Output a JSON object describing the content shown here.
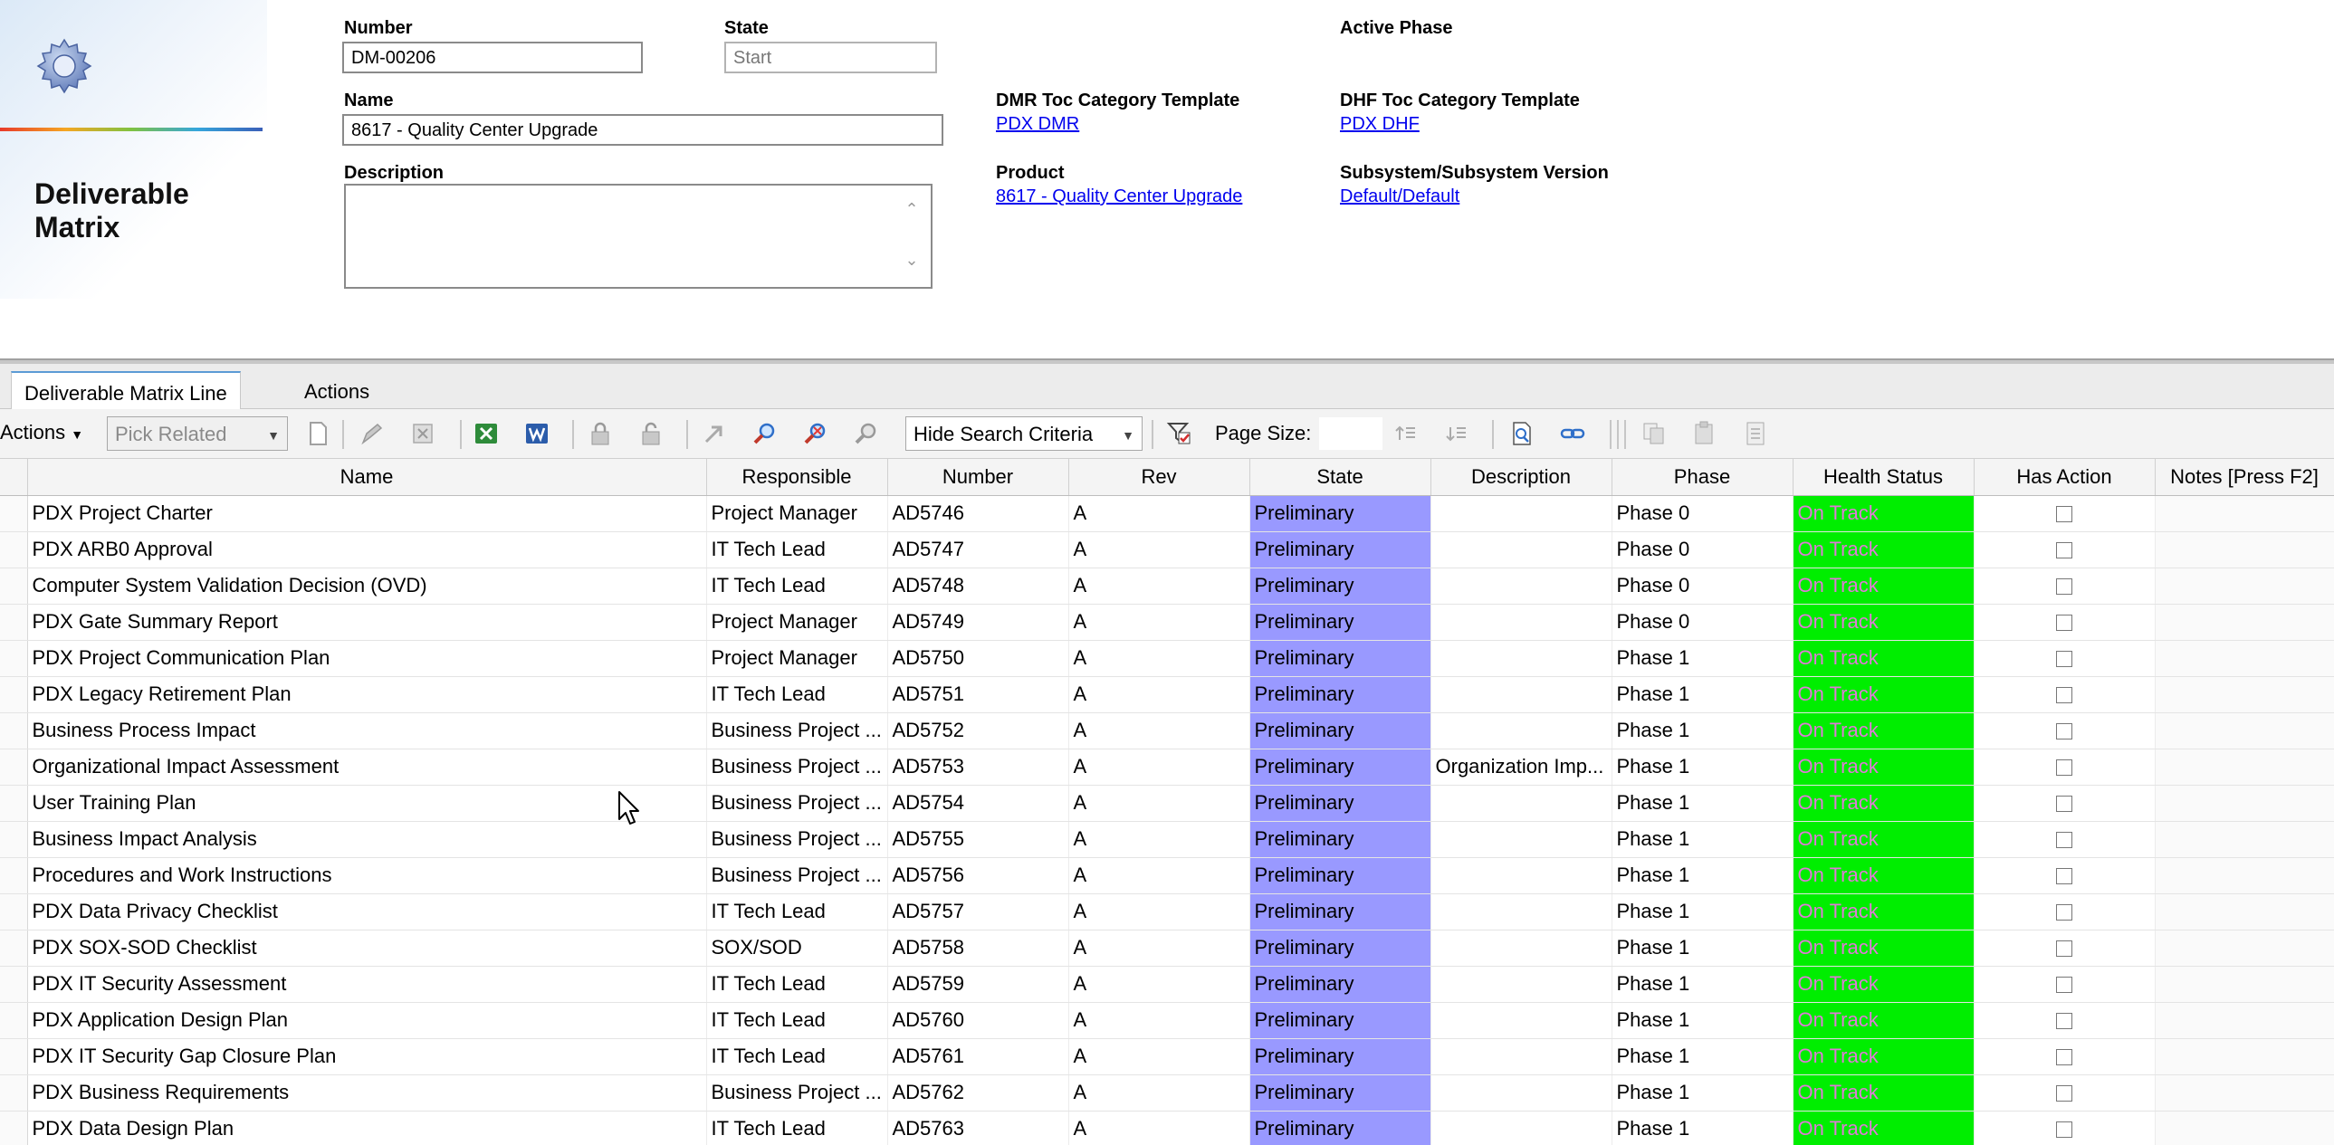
{
  "header": {
    "title": "Deliverable Matrix",
    "number": {
      "label": "Number",
      "value": "DM-00206"
    },
    "state": {
      "label": "State",
      "value": "Start"
    },
    "name": {
      "label": "Name",
      "value": "8617 - Quality Center Upgrade"
    },
    "description": {
      "label": "Description",
      "value": ""
    },
    "active_phase": {
      "label": "Active Phase"
    },
    "dmr_toc": {
      "label": "DMR Toc Category Template",
      "link": "PDX DMR"
    },
    "product": {
      "label": "Product",
      "link": "8617 - Quality Center Upgrade"
    },
    "dhf_toc": {
      "label": "DHF Toc Category Template",
      "link": "PDX DHF"
    },
    "subsystem": {
      "label": "Subsystem/Subsystem Version",
      "link": "Default/Default"
    }
  },
  "tabs": [
    {
      "label": "Deliverable Matrix Line",
      "active": true
    },
    {
      "label": "Actions",
      "active": false
    }
  ],
  "toolbar": {
    "actions_label": "Actions",
    "pick_related": "Pick Related",
    "hide_search": "Hide Search Criteria",
    "page_size_label": "Page Size:",
    "page_size_value": ""
  },
  "grid": {
    "columns": [
      "Name",
      "Responsible",
      "Number",
      "Rev",
      "State",
      "Description",
      "Phase",
      "Health Status",
      "Has Action",
      "Notes [Press F2]"
    ],
    "rows": [
      {
        "name": "PDX Project Charter",
        "responsible": "Project Manager",
        "number": "AD5746",
        "rev": "A",
        "state": "Preliminary",
        "description": "",
        "phase": "Phase 0",
        "health": "On Track"
      },
      {
        "name": "PDX ARB0 Approval",
        "responsible": "IT Tech Lead",
        "number": "AD5747",
        "rev": "A",
        "state": "Preliminary",
        "description": "",
        "phase": "Phase 0",
        "health": "On Track"
      },
      {
        "name": "Computer System Validation Decision (OVD)",
        "responsible": "IT Tech Lead",
        "number": "AD5748",
        "rev": "A",
        "state": "Preliminary",
        "description": "",
        "phase": "Phase 0",
        "health": "On Track"
      },
      {
        "name": "PDX Gate Summary Report",
        "responsible": "Project Manager",
        "number": "AD5749",
        "rev": "A",
        "state": "Preliminary",
        "description": "",
        "phase": "Phase 0",
        "health": "On Track"
      },
      {
        "name": "PDX Project Communication Plan",
        "responsible": "Project Manager",
        "number": "AD5750",
        "rev": "A",
        "state": "Preliminary",
        "description": "",
        "phase": "Phase 1",
        "health": "On Track"
      },
      {
        "name": "PDX Legacy Retirement Plan",
        "responsible": "IT Tech Lead",
        "number": "AD5751",
        "rev": "A",
        "state": "Preliminary",
        "description": "",
        "phase": "Phase 1",
        "health": "On Track"
      },
      {
        "name": "Business Process Impact",
        "responsible": "Business Project ...",
        "number": "AD5752",
        "rev": "A",
        "state": "Preliminary",
        "description": "",
        "phase": "Phase 1",
        "health": "On Track"
      },
      {
        "name": "Organizational Impact Assessment",
        "responsible": "Business Project ...",
        "number": "AD5753",
        "rev": "A",
        "state": "Preliminary",
        "description": "Organization Imp...",
        "phase": "Phase 1",
        "health": "On Track"
      },
      {
        "name": "User Training Plan",
        "responsible": "Business Project ...",
        "number": "AD5754",
        "rev": "A",
        "state": "Preliminary",
        "description": "",
        "phase": "Phase 1",
        "health": "On Track"
      },
      {
        "name": "Business Impact Analysis",
        "responsible": "Business Project ...",
        "number": "AD5755",
        "rev": "A",
        "state": "Preliminary",
        "description": "",
        "phase": "Phase 1",
        "health": "On Track"
      },
      {
        "name": "Procedures and Work Instructions",
        "responsible": "Business Project ...",
        "number": "AD5756",
        "rev": "A",
        "state": "Preliminary",
        "description": "",
        "phase": "Phase 1",
        "health": "On Track"
      },
      {
        "name": "PDX Data Privacy Checklist",
        "responsible": "IT Tech Lead",
        "number": "AD5757",
        "rev": "A",
        "state": "Preliminary",
        "description": "",
        "phase": "Phase 1",
        "health": "On Track"
      },
      {
        "name": "PDX SOX-SOD Checklist",
        "responsible": "SOX/SOD",
        "number": "AD5758",
        "rev": "A",
        "state": "Preliminary",
        "description": "",
        "phase": "Phase 1",
        "health": "On Track"
      },
      {
        "name": "PDX IT Security Assessment",
        "responsible": "IT Tech Lead",
        "number": "AD5759",
        "rev": "A",
        "state": "Preliminary",
        "description": "",
        "phase": "Phase 1",
        "health": "On Track"
      },
      {
        "name": "PDX Application Design Plan",
        "responsible": "IT Tech Lead",
        "number": "AD5760",
        "rev": "A",
        "state": "Preliminary",
        "description": "",
        "phase": "Phase 1",
        "health": "On Track"
      },
      {
        "name": "PDX IT Security Gap Closure Plan",
        "responsible": "IT Tech Lead",
        "number": "AD5761",
        "rev": "A",
        "state": "Preliminary",
        "description": "",
        "phase": "Phase 1",
        "health": "On Track"
      },
      {
        "name": "PDX Business Requirements",
        "responsible": "Business Project ...",
        "number": "AD5762",
        "rev": "A",
        "state": "Preliminary",
        "description": "",
        "phase": "Phase 1",
        "health": "On Track"
      },
      {
        "name": "PDX Data Design Plan",
        "responsible": "IT Tech Lead",
        "number": "AD5763",
        "rev": "A",
        "state": "Preliminary",
        "description": "",
        "phase": "Phase 1",
        "health": "On Track"
      }
    ]
  },
  "colors": {
    "state_bg": "#9999ff",
    "health_bg": "#00ee00",
    "health_text": "#e07ad8"
  }
}
